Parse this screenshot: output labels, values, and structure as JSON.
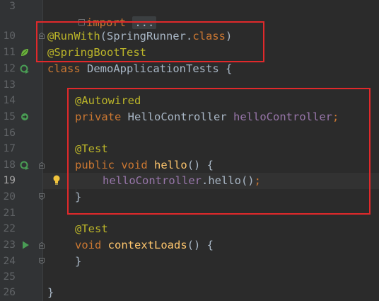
{
  "lines": [
    {
      "n": "3"
    },
    {
      "n": "10"
    },
    {
      "n": "11"
    },
    {
      "n": "12"
    },
    {
      "n": "13"
    },
    {
      "n": "14"
    },
    {
      "n": "15"
    },
    {
      "n": "16"
    },
    {
      "n": "17"
    },
    {
      "n": "18"
    },
    {
      "n": "19"
    },
    {
      "n": "20"
    },
    {
      "n": "21"
    },
    {
      "n": "22"
    },
    {
      "n": "23"
    },
    {
      "n": "24"
    },
    {
      "n": "25"
    },
    {
      "n": "26"
    }
  ],
  "code": {
    "import_kw": "import",
    "import_folded": "...",
    "runwith_ann": "@RunWith",
    "runwith_open": "(SpringRunner.",
    "runwith_class": "class",
    "runwith_close": ")",
    "springboot_ann": "@SpringBootTest",
    "class_kw": "class",
    "class_name": "DemoApplicationTests {",
    "autowired_ann": "@Autowired",
    "private_kw": "private",
    "hello_type": "HelloController",
    "hello_field": "helloController",
    "semicolon": ";",
    "test_ann": "@Test",
    "public_kw": "public",
    "void_kw": "void",
    "hello_method": "hello",
    "method_open": "() {",
    "call_field": "helloController",
    "call_rest": ".hello()",
    "close_brace": "}",
    "test_ann2": "@Test",
    "void_kw2": "void",
    "context_method": "contextLoads",
    "context_open": "() {",
    "close_brace2": "}",
    "class_close": "}"
  },
  "colors": {
    "highlight_box": "#e0292b",
    "keyword": "#cc7832",
    "annotation": "#bbb529",
    "field": "#9876aa",
    "method": "#ffc66d",
    "run_icon": "#499c54"
  }
}
